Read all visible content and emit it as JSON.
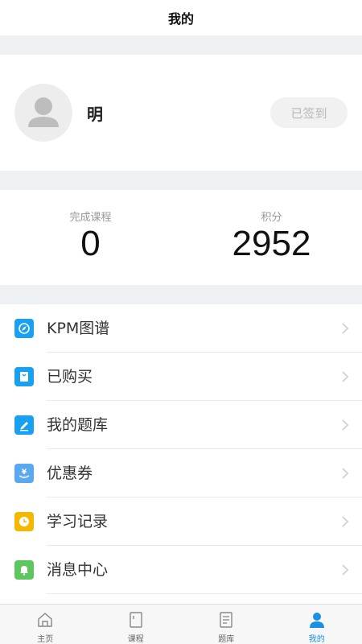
{
  "header": {
    "title": "我的"
  },
  "profile": {
    "username": "明",
    "signin_label": "已签到"
  },
  "stats": {
    "completed_label": "完成课程",
    "completed_value": "0",
    "points_label": "积分",
    "points_value": "2952"
  },
  "menu": {
    "items": [
      {
        "label": "KPM图谱",
        "icon": "compass-icon",
        "color": "#1aa0f0"
      },
      {
        "label": "已购买",
        "icon": "shopping-bag-icon",
        "color": "#1aa0f0"
      },
      {
        "label": "我的题库",
        "icon": "edit-pen-icon",
        "color": "#1aa0f0"
      },
      {
        "label": "优惠券",
        "icon": "coupon-icon",
        "color": "#5aa8f0"
      },
      {
        "label": "学习记录",
        "icon": "clock-icon",
        "color": "#f5b800"
      },
      {
        "label": "消息中心",
        "icon": "bell-icon",
        "color": "#5dc65d"
      }
    ]
  },
  "tabbar": {
    "tabs": [
      {
        "label": "主页",
        "icon": "home-icon",
        "active": false
      },
      {
        "label": "课程",
        "icon": "book-icon",
        "active": false
      },
      {
        "label": "题库",
        "icon": "question-bank-icon",
        "active": false
      },
      {
        "label": "我的",
        "icon": "user-icon",
        "active": true
      }
    ],
    "active_color": "#1a8fe3"
  }
}
